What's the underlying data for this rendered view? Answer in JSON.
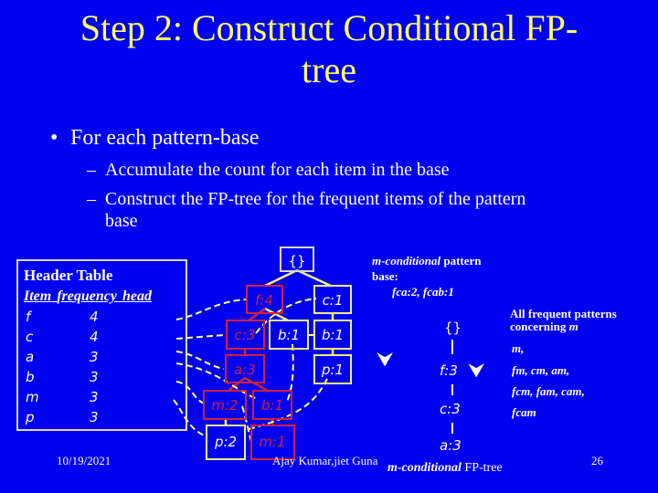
{
  "slide": {
    "title_line1": "Step 2: Construct Conditional FP-",
    "title_line2": "tree",
    "bullet": "For each pattern-base",
    "bullet_marker": "•",
    "sub_marker": "–",
    "sub_items": [
      {
        "text": "Accumulate the count for each item in the base",
        "cont": ""
      },
      {
        "text": "Construct the FP-tree for the frequent items of the pattern",
        "cont": "base"
      }
    ],
    "colors": {
      "background": "#0000F0",
      "title": "#FFFF66",
      "text": "#FFFFFF",
      "red_node": "#D02040",
      "yellow_node": "#F0F080",
      "link": "#FFFF80"
    }
  },
  "header_table": {
    "title": "Header Table",
    "columns": [
      "Item",
      "frequency",
      "head"
    ],
    "rows": [
      {
        "item": "f",
        "frequency": "4"
      },
      {
        "item": "c",
        "frequency": "4"
      },
      {
        "item": "a",
        "frequency": "3"
      },
      {
        "item": "b",
        "frequency": "3"
      },
      {
        "item": "m",
        "frequency": "3"
      },
      {
        "item": "p",
        "frequency": "3"
      }
    ]
  },
  "fp_tree": {
    "root": "{}",
    "nodes": [
      {
        "id": "f4",
        "label": "f:4",
        "highlight": true
      },
      {
        "id": "c1",
        "label": "c:1",
        "highlight": false
      },
      {
        "id": "c3",
        "label": "c:3",
        "highlight": true
      },
      {
        "id": "b1a",
        "label": "b:1",
        "highlight": false
      },
      {
        "id": "b1b",
        "label": "b:1",
        "highlight": false
      },
      {
        "id": "a3",
        "label": "a:3",
        "highlight": true
      },
      {
        "id": "p1",
        "label": "p:1",
        "highlight": false
      },
      {
        "id": "m2",
        "label": "m:2",
        "highlight": true
      },
      {
        "id": "b1c",
        "label": "b:1",
        "highlight": true
      },
      {
        "id": "p2",
        "label": "p:2",
        "highlight": false
      },
      {
        "id": "m1",
        "label": "m:1",
        "highlight": true
      }
    ]
  },
  "conditional_pattern_base": {
    "label_italic": "m-conditional",
    "label_rest": " pattern",
    "label_line2": "base:",
    "values": "fca:2, fcab:1"
  },
  "conditional_tree": {
    "root": "{}",
    "nodes": [
      "f:3",
      "c:3",
      "a:3"
    ],
    "caption_italic": "m-conditional",
    "caption_rest": " FP-tree"
  },
  "frequent_patterns": {
    "heading_line1": "All frequent patterns",
    "heading_line2": "concerning ",
    "heading_item": "m",
    "lines": [
      "m,",
      "fm, cm, am,",
      "fcm, fam, cam,",
      "fcam"
    ]
  },
  "arrows": {
    "glyph": "⮟"
  },
  "footer": {
    "date": "10/19/2021",
    "author": "Ajay Kumar,jiet Guna",
    "page": "26"
  }
}
